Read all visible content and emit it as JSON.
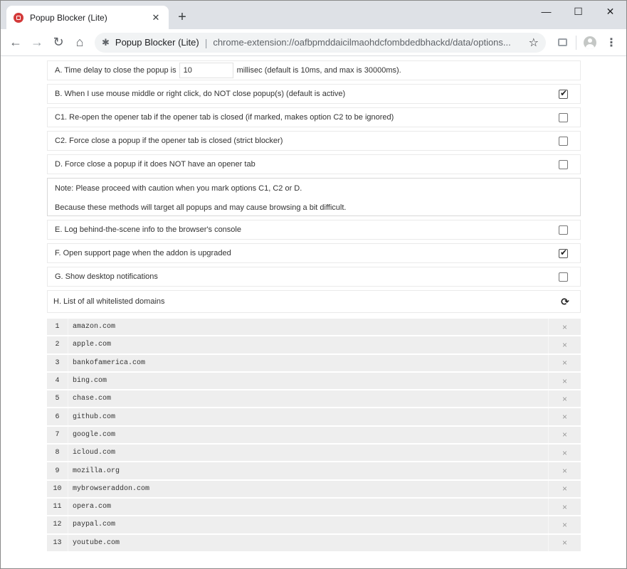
{
  "browser": {
    "tab_title": "Popup Blocker (Lite)",
    "tab_close": "✕",
    "new_tab": "+",
    "window_controls": {
      "minimize": "—",
      "maximize": "☐",
      "close": "✕"
    },
    "nav": {
      "back": "←",
      "forward": "→",
      "reload": "↻",
      "home": "⌂"
    },
    "omnibox": {
      "site_name": "Popup Blocker (Lite)",
      "separator": "|",
      "url": "chrome-extension://oafbpmddaicilmaohdcfombdedbhackd/data/options...",
      "star": "☆"
    },
    "menu": "⋮"
  },
  "options": {
    "a": {
      "prefix": "A. Time delay to close the popup is",
      "value": "10",
      "suffix": "millisec (default is 10ms, and max is 30000ms)."
    },
    "b": {
      "label": "B. When I use mouse middle or right click, do NOT close popup(s) (default is active)",
      "checked": true
    },
    "c1": {
      "label": "C1. Re-open the opener tab if the opener tab is closed (if marked, makes option C2 to be ignored)",
      "checked": false
    },
    "c2": {
      "label": "C2. Force close a popup if the opener tab is closed (strict blocker)",
      "checked": false
    },
    "d": {
      "label": "D. Force close a popup if it does NOT have an opener tab",
      "checked": false
    },
    "note": {
      "line1": "Note: Please proceed with caution when you mark options C1, C2 or D.",
      "line2": "Because these methods will target all popups and may cause browsing a bit difficult."
    },
    "e": {
      "label": "E. Log behind-the-scene info to the browser's console",
      "checked": false
    },
    "f": {
      "label": "F. Open support page when the addon is upgraded",
      "checked": true
    },
    "g": {
      "label": "G. Show desktop notifications",
      "checked": false
    },
    "h": {
      "label": "H. List of all whitelisted domains",
      "reload_icon": "⟳"
    }
  },
  "whitelist": {
    "delete_glyph": "×",
    "domains": [
      {
        "index": "1",
        "domain": "amazon.com"
      },
      {
        "index": "2",
        "domain": "apple.com"
      },
      {
        "index": "3",
        "domain": "bankofamerica.com"
      },
      {
        "index": "4",
        "domain": "bing.com"
      },
      {
        "index": "5",
        "domain": "chase.com"
      },
      {
        "index": "6",
        "domain": "github.com"
      },
      {
        "index": "7",
        "domain": "google.com"
      },
      {
        "index": "8",
        "domain": "icloud.com"
      },
      {
        "index": "9",
        "domain": "mozilla.org"
      },
      {
        "index": "10",
        "domain": "mybrowseraddon.com"
      },
      {
        "index": "11",
        "domain": "opera.com"
      },
      {
        "index": "12",
        "domain": "paypal.com"
      },
      {
        "index": "13",
        "domain": "youtube.com"
      }
    ]
  },
  "colors": {
    "favicon": "#d33a3a",
    "tabstrip": "#dee1e6",
    "row_bg": "#eeeeee"
  }
}
